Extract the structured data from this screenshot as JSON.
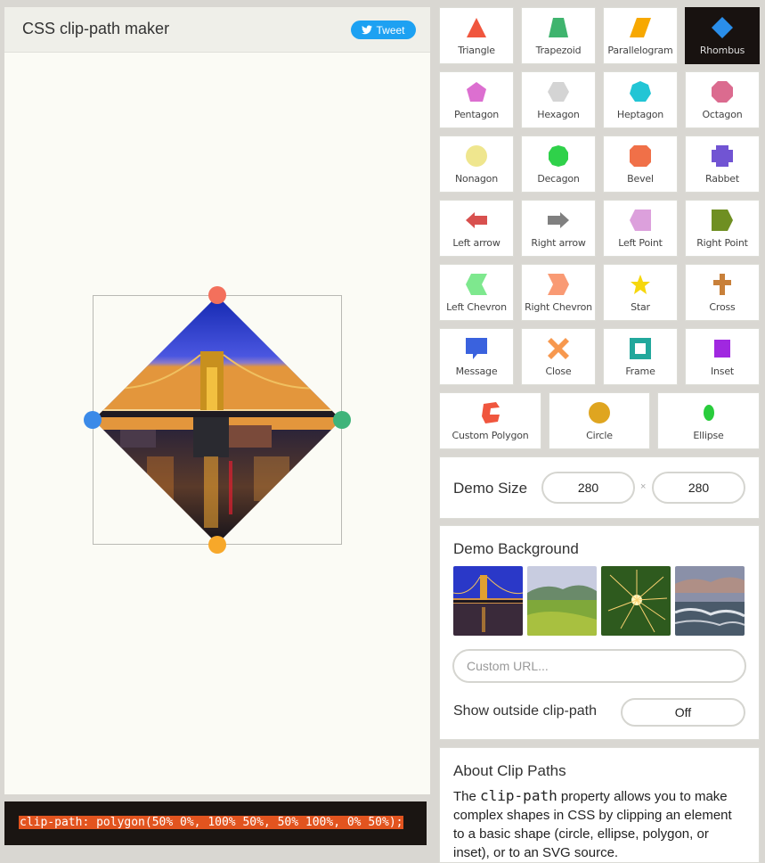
{
  "app": {
    "title": "CSS clip-path maker",
    "tweet_label": "Tweet"
  },
  "code": {
    "text": "clip-path: polygon(50% 0%, 100% 50%, 50% 100%, 0% 50%);"
  },
  "shapes": [
    {
      "label": "Triangle",
      "icon": "triangle-icon",
      "color": "#f0563e"
    },
    {
      "label": "Trapezoid",
      "icon": "trapezoid-icon",
      "color": "#3fb46e"
    },
    {
      "label": "Parallelogram",
      "icon": "parallelogram-icon",
      "color": "#f7a800"
    },
    {
      "label": "Rhombus",
      "icon": "rhombus-icon",
      "color": "#2a8eea",
      "selected": true
    },
    {
      "label": "Pentagon",
      "icon": "pentagon-icon",
      "color": "#dc6fd0"
    },
    {
      "label": "Hexagon",
      "icon": "hexagon-icon",
      "color": "#d4d4d4"
    },
    {
      "label": "Heptagon",
      "icon": "heptagon-icon",
      "color": "#22c5d5"
    },
    {
      "label": "Octagon",
      "icon": "octagon-icon",
      "color": "#db6b8f"
    },
    {
      "label": "Nonagon",
      "icon": "nonagon-icon",
      "color": "#efe68e"
    },
    {
      "label": "Decagon",
      "icon": "decagon-icon",
      "color": "#2fd14a"
    },
    {
      "label": "Bevel",
      "icon": "bevel-icon",
      "color": "#f07048"
    },
    {
      "label": "Rabbet",
      "icon": "rabbet-icon",
      "color": "#7154d3"
    },
    {
      "label": "Left arrow",
      "icon": "left-arrow-icon",
      "color": "#d8504e"
    },
    {
      "label": "Right arrow",
      "icon": "right-arrow-icon",
      "color": "#808080"
    },
    {
      "label": "Left Point",
      "icon": "left-point-icon",
      "color": "#dca0dc"
    },
    {
      "label": "Right Point",
      "icon": "right-point-icon",
      "color": "#6f8f22"
    },
    {
      "label": "Left Chevron",
      "icon": "left-chevron-icon",
      "color": "#7ee88e"
    },
    {
      "label": "Right Chevron",
      "icon": "right-chevron-icon",
      "color": "#f99a74"
    },
    {
      "label": "Star",
      "icon": "star-icon",
      "color": "#f6d70c"
    },
    {
      "label": "Cross",
      "icon": "cross-icon",
      "color": "#c8803a"
    },
    {
      "label": "Message",
      "icon": "message-icon",
      "color": "#3a62de"
    },
    {
      "label": "Close",
      "icon": "close-icon",
      "color": "#f7984e"
    },
    {
      "label": "Frame",
      "icon": "frame-icon",
      "color": "#22a89c"
    },
    {
      "label": "Inset",
      "icon": "inset-icon",
      "color": "#a028e0"
    },
    {
      "label": "Custom Polygon",
      "icon": "custom-polygon-icon",
      "color": "#f0563e"
    },
    {
      "label": "Circle",
      "icon": "circle-icon",
      "color": "#dfa520"
    },
    {
      "label": "Ellipse",
      "icon": "ellipse-icon",
      "color": "#29cc3c"
    }
  ],
  "demo_size": {
    "label": "Demo Size",
    "width": "280",
    "separator": "×",
    "height": "280"
  },
  "demo_background": {
    "label": "Demo Background",
    "thumbnails": [
      "bridge-night-thumbnail",
      "green-hills-thumbnail",
      "sparkler-thumbnail",
      "ocean-waves-thumbnail"
    ],
    "url_placeholder": "Custom URL...",
    "show_outside_label": "Show outside clip-path",
    "show_outside_value": "Off"
  },
  "about": {
    "title": "About Clip Paths",
    "text_before": "The ",
    "code_word": "clip-path",
    "text_after": " property allows you to make complex shapes in CSS by clipping an element to a basic shape (circle, ellipse, polygon, or inset), or to an SVG source."
  }
}
